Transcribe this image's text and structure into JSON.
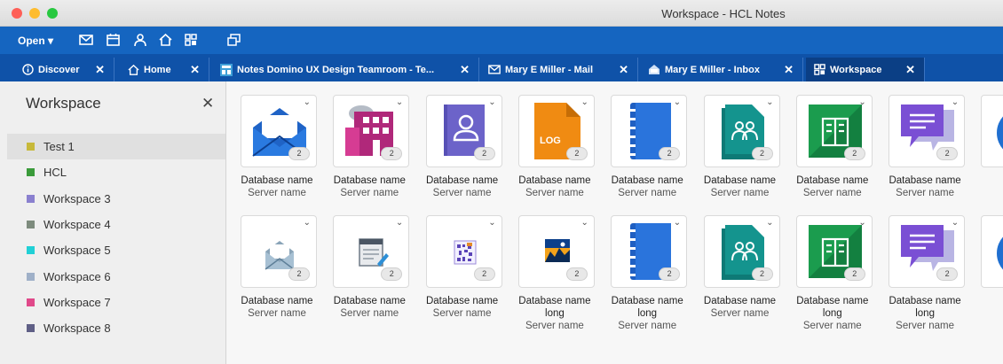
{
  "window": {
    "title": "Workspace - HCL Notes"
  },
  "menubar": {
    "open_label": "Open",
    "icons": [
      "mail-icon",
      "calendar-icon",
      "contacts-icon",
      "home-icon",
      "workspace-icon",
      "windows-icon"
    ]
  },
  "tabs": [
    {
      "label": "Discover",
      "icon": "info-icon",
      "active": false
    },
    {
      "label": "Home",
      "icon": "home-icon",
      "active": false
    },
    {
      "label": "Notes Domino UX Design Teamroom - Te...",
      "icon": "teamroom-icon",
      "active": false
    },
    {
      "label": "Mary E Miller - Mail",
      "icon": "mail-icon",
      "active": false
    },
    {
      "label": "Mary E Miller - Inbox",
      "icon": "inbox-icon",
      "active": false
    },
    {
      "label": "Workspace",
      "icon": "workspace-icon",
      "active": true
    }
  ],
  "sidebar": {
    "title": "Workspace",
    "items": [
      {
        "label": "Test 1",
        "color": "#c7b93a",
        "selected": true
      },
      {
        "label": "HCL",
        "color": "#3a9b3a",
        "selected": false
      },
      {
        "label": "Workspace 3",
        "color": "#8a80cf",
        "selected": false
      },
      {
        "label": "Workspace 4",
        "color": "#7d8b7d",
        "selected": false
      },
      {
        "label": "Workspace 5",
        "color": "#21d0d6",
        "selected": false
      },
      {
        "label": "Workspace 6",
        "color": "#9fb0c8",
        "selected": false
      },
      {
        "label": "Workspace 7",
        "color": "#e0498a",
        "selected": false
      },
      {
        "label": "Workspace 8",
        "color": "#5f5f86",
        "selected": false
      }
    ]
  },
  "rows": [
    [
      {
        "icon": "mail-envelope-icon",
        "name": "Database name",
        "server": "Server name",
        "badge": "2"
      },
      {
        "icon": "building-icon",
        "name": "Database name",
        "server": "Server name",
        "badge": "2"
      },
      {
        "icon": "contacts-book-icon",
        "name": "Database name",
        "server": "Server name",
        "badge": "2"
      },
      {
        "icon": "log-document-icon",
        "name": "Database name",
        "server": "Server name",
        "badge": "2"
      },
      {
        "icon": "notebook-icon",
        "name": "Database name",
        "server": "Server name",
        "badge": "2"
      },
      {
        "icon": "team-document-icon",
        "name": "Database name",
        "server": "Server name",
        "badge": "2"
      },
      {
        "icon": "office-building-icon",
        "name": "Database name",
        "server": "Server name",
        "badge": "2"
      },
      {
        "icon": "chat-bubble-icon",
        "name": "Database name",
        "server": "Server name",
        "badge": "2"
      },
      {
        "icon": "circle-db-icon",
        "name": "Data",
        "server": "Ser",
        "badge": ""
      }
    ],
    [
      {
        "icon": "mail-envelope-small-icon",
        "name": "Database name",
        "server": "Server name",
        "badge": "2"
      },
      {
        "icon": "form-document-icon",
        "name": "Database name",
        "server": "Server name",
        "badge": "2"
      },
      {
        "icon": "qr-document-icon",
        "name": "Database name",
        "server": "Server name",
        "badge": "2"
      },
      {
        "icon": "landscape-image-icon",
        "name": "Database name long",
        "server": "Server name",
        "badge": "2"
      },
      {
        "icon": "notebook-icon",
        "name": "Database name long",
        "server": "Server name",
        "badge": "2"
      },
      {
        "icon": "team-document-icon",
        "name": "Database name",
        "server": "Server name",
        "badge": "2"
      },
      {
        "icon": "office-building-icon",
        "name": "Database name long",
        "server": "Server name",
        "badge": "2"
      },
      {
        "icon": "chat-bubble-icon",
        "name": "Database name long",
        "server": "Server name",
        "badge": "2"
      },
      {
        "icon": "circle-db-icon",
        "name": "Data",
        "server": "Ser",
        "badge": ""
      }
    ]
  ]
}
